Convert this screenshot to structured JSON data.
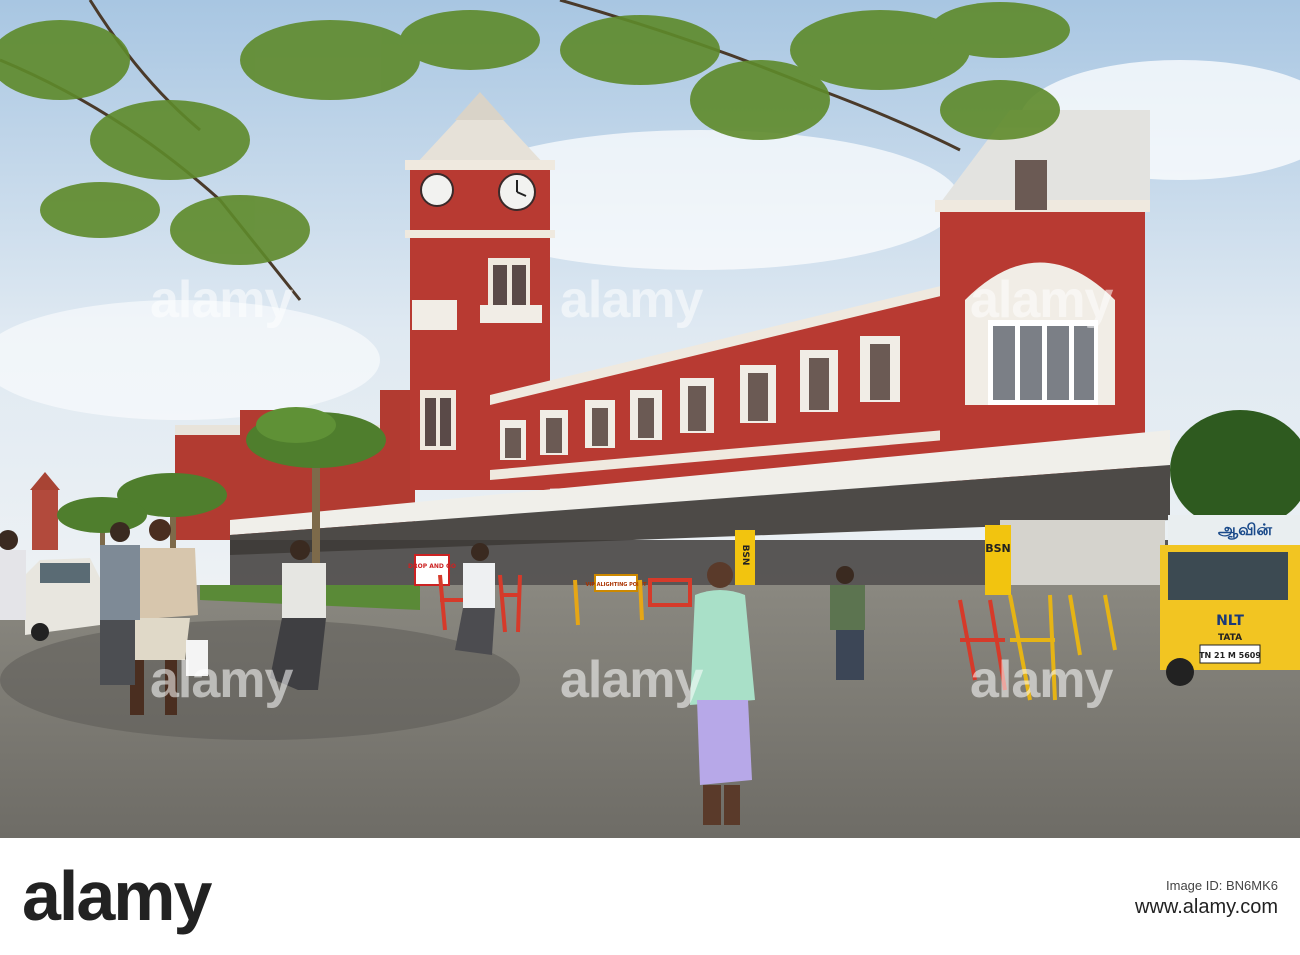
{
  "watermark": {
    "brand": "alamy"
  },
  "footer": {
    "logo": "alamy",
    "id_label": "Image ID: BN6MK6",
    "id_value": "www.alamy.com"
  },
  "signs": {
    "drop_go": "DROP AND GO",
    "alighting": "VIP ALIGHTING POINT",
    "bsnl_left": "BSN",
    "bsnl_right": "BSN",
    "truck_tamil": "ஆவின்",
    "truck_brand": "NLT",
    "truck_make": "TATA",
    "plate": "TN 21 M 5609"
  },
  "colors": {
    "sky": "#cfe0ef",
    "brick": "#b83a32",
    "road": "#7a7872",
    "leaf": "#5e8a2a"
  }
}
